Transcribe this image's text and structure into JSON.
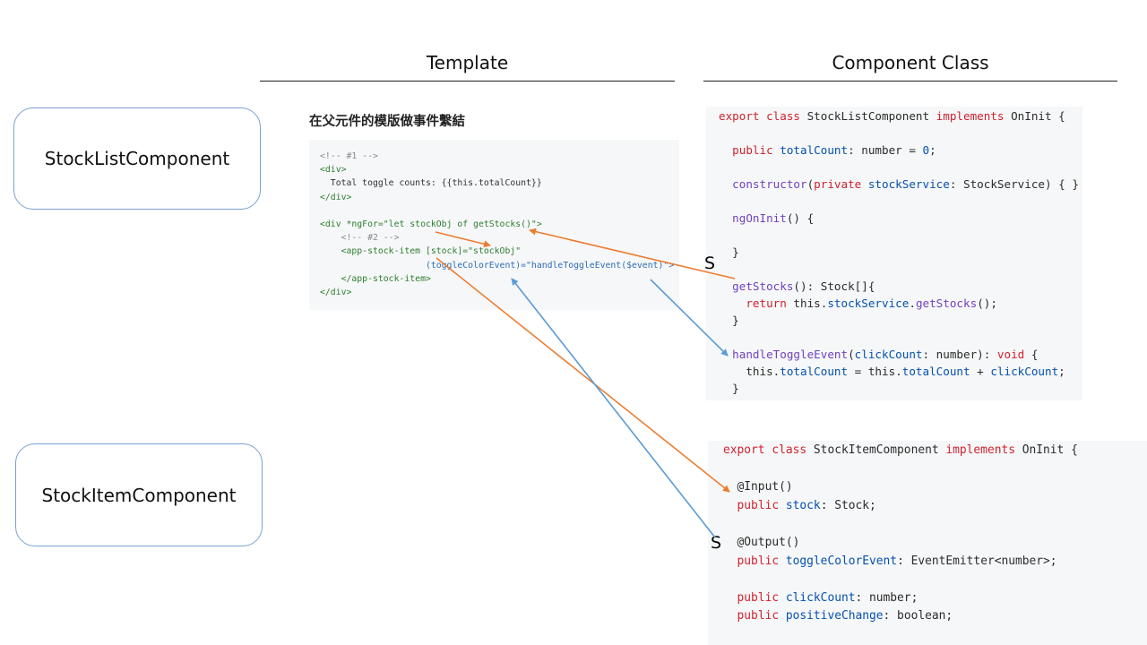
{
  "columns": {
    "template_title": "Template",
    "class_title": "Component Class"
  },
  "components": {
    "list": "StockListComponent",
    "item": "StockItemComponent"
  },
  "template_heading": "在父元件的模版做事件繫結",
  "template_code": [
    "<!-- #1 -->",
    "<div>",
    "  Total toggle counts: {{this.totalCount}}",
    "</div>",
    "",
    "<div *ngFor=\"let stockObj of getStocks()\">",
    "    <!-- #2 -->",
    "    <app-stock-item [stock]=\"stockObj\"",
    "                    (toggleColorEvent)=\"handleToggleEvent($event)\">",
    "    </app-stock-item>",
    "</div>"
  ],
  "list_class_code": [
    "export class StockListComponent implements OnInit {",
    "",
    "  public totalCount: number = 0;",
    "",
    "  constructor(private stockService: StockService) { }",
    "",
    "  ngOnInit() {",
    "",
    "  }",
    "",
    "  getStocks(): Stock[]{",
    "    return this.stockService.getStocks();",
    "  }",
    "",
    "  handleToggleEvent(clickCount: number): void {",
    "    this.totalCount = this.totalCount + clickCount;",
    "  }"
  ],
  "item_class_code": [
    "export class StockItemComponent implements OnInit {",
    "",
    "  @Input()",
    "  public stock: Stock;",
    "",
    "  @Output()",
    "  public toggleColorEvent: EventEmitter<number>;",
    "",
    "  public clickCount: number;",
    "  public positiveChange: boolean;"
  ],
  "markers": {
    "s1": "S",
    "s2": "S"
  },
  "colors": {
    "orange_arrow": "#ed7d31",
    "blue_arrow": "#5b9bd5",
    "box_border": "#7ba3cf"
  }
}
